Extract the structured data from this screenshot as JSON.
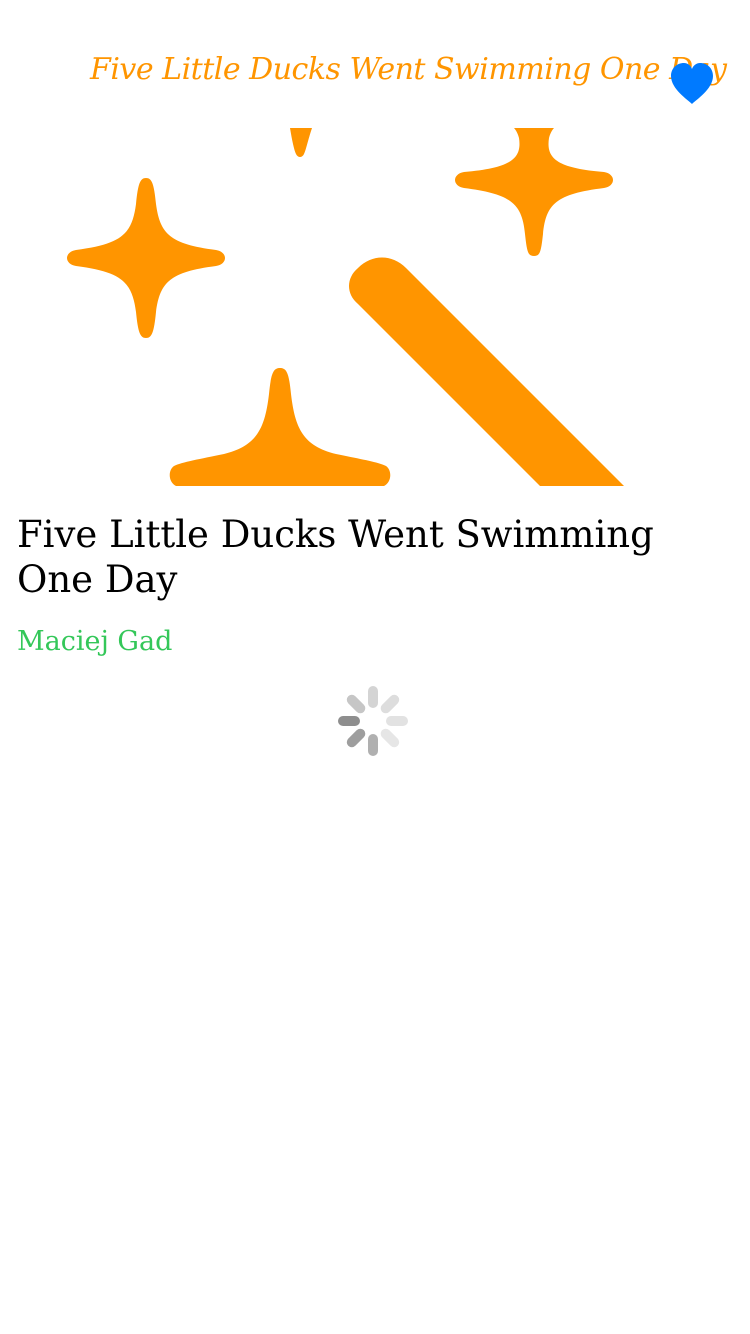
{
  "nav": {
    "title": "Five Little Ducks Went Swimming One Day",
    "favorite_icon": "heart-icon",
    "title_color": "#ff9500",
    "heart_color": "#007aff"
  },
  "hero": {
    "icon": "magic-wand-sparkles-icon",
    "color": "#ff9500"
  },
  "book": {
    "title": "Five Little Ducks Went Swimming One Day",
    "author": "Maciej Gad",
    "author_color": "#34c759"
  },
  "status": {
    "loading_icon": "activity-spinner-icon"
  }
}
